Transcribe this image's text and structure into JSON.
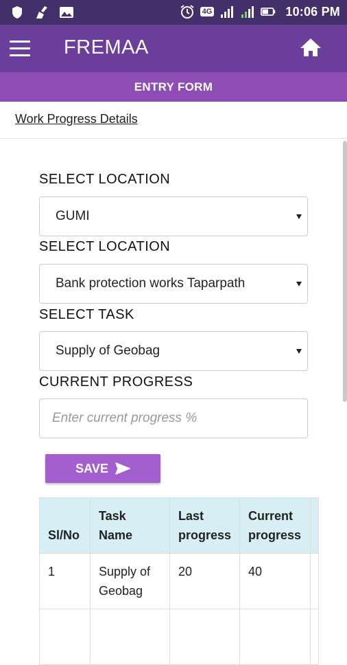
{
  "status_bar": {
    "time": "10:06 PM",
    "network": "4G",
    "sim2": "2",
    "icons": [
      "shield-icon",
      "broom-icon",
      "image-icon",
      "alarm-icon",
      "network-4g-icon",
      "signal-icon",
      "signal-2-icon",
      "battery-icon"
    ]
  },
  "app_bar": {
    "title": "FREMAA",
    "menu_icon": "hamburger-menu-icon",
    "home_icon": "home-icon"
  },
  "entry_bar": {
    "label": "ENTRY FORM"
  },
  "breadcrumb": {
    "label": "Work Progress Details"
  },
  "form": {
    "location1_label": "SELECT LOCATION",
    "location1_value": "GUMI",
    "location2_label": "SELECT LOCATION",
    "location2_value": "Bank protection works Taparpath",
    "task_label": "SELECT TASK",
    "task_value": "Supply of Geobag",
    "progress_label": "CURRENT PROGRESS",
    "progress_placeholder": "Enter current progress %",
    "save_label": "SAVE"
  },
  "table": {
    "headers": [
      "Sl/No",
      "Task Name",
      "Last progress",
      "Current progress",
      ""
    ],
    "rows": [
      [
        "1",
        "Supply of Geobag",
        "20",
        "40",
        ""
      ],
      [
        "",
        "",
        "",
        "",
        ""
      ]
    ]
  },
  "colors": {
    "status_bar": "#43306b",
    "app_bar": "#6a3e9a",
    "entry_bar": "#8d4db5",
    "save_button": "#a45fce",
    "table_header": "#d8eef5"
  }
}
